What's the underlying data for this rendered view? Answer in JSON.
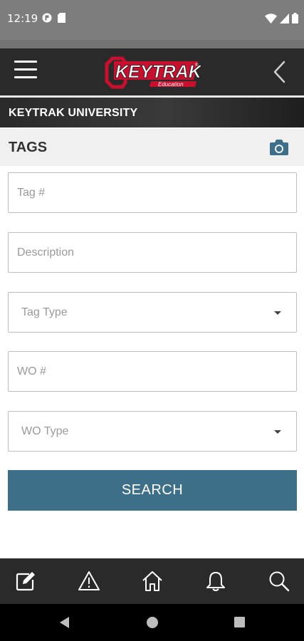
{
  "status_bar": {
    "time": "12:19",
    "left_icons": [
      "notification-app-icon",
      "sd-card-icon"
    ],
    "right_icons": [
      "wifi-icon",
      "cell-signal-icon",
      "battery-icon"
    ]
  },
  "header": {
    "logo_text": "KEYTRAK",
    "logo_subtext": "Education",
    "menu_icon": "hamburger-icon",
    "back_icon": "chevron-left-icon"
  },
  "section": {
    "title": "KEYTRAK UNIVERSITY"
  },
  "page": {
    "title": "TAGS",
    "action_icon": "camera-icon"
  },
  "form": {
    "tag_number": {
      "placeholder": "Tag #",
      "value": ""
    },
    "description": {
      "placeholder": "Description",
      "value": ""
    },
    "tag_type": {
      "selected": "Tag Type"
    },
    "wo_number": {
      "placeholder": "WO #",
      "value": ""
    },
    "wo_type": {
      "selected": "WO Type"
    },
    "search_label": "SEARCH"
  },
  "bottom_nav": {
    "items": [
      {
        "icon": "edit-icon"
      },
      {
        "icon": "warning-icon"
      },
      {
        "icon": "home-icon"
      },
      {
        "icon": "bell-icon"
      },
      {
        "icon": "search-icon"
      }
    ]
  },
  "colors": {
    "header_bg": "#2a2a2a",
    "accent": "#3e6f89",
    "logo_red": "#c8102e",
    "status_bar_bg": "#7d7d7d"
  }
}
